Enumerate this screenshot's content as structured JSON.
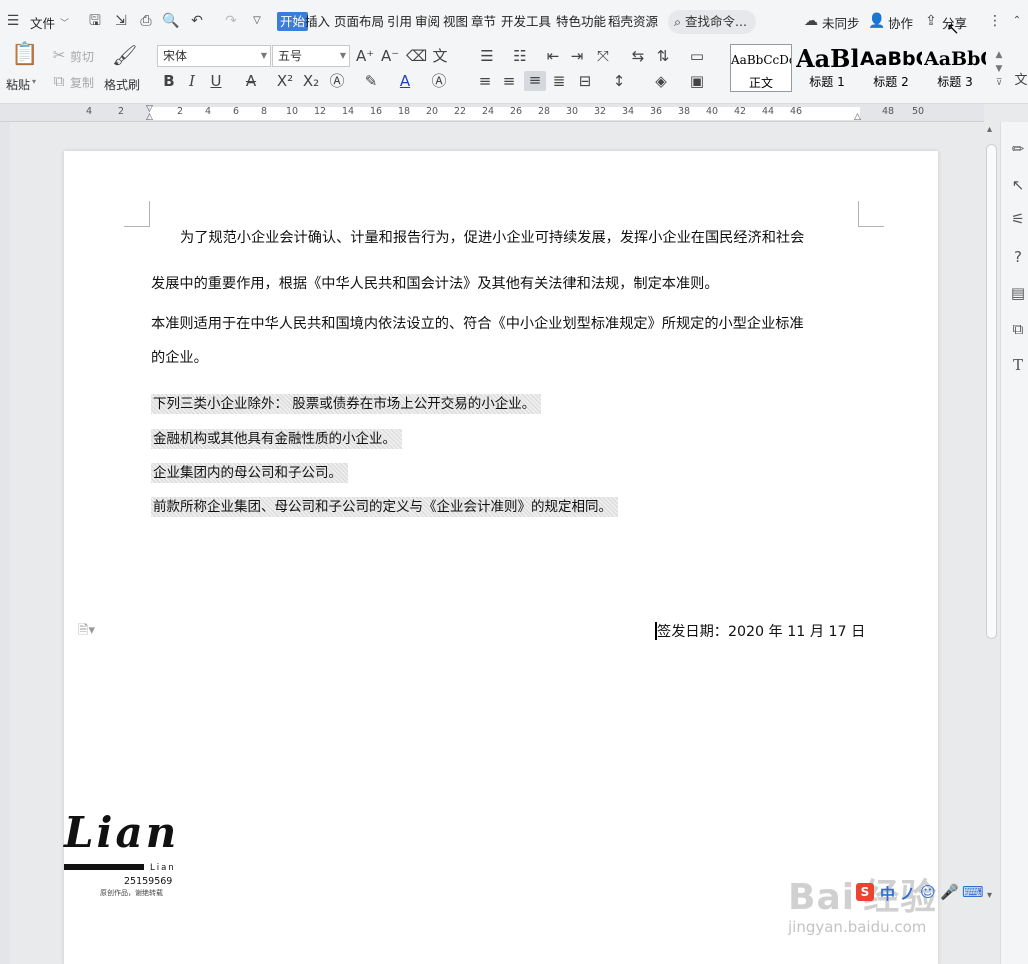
{
  "menubar": {
    "file_label": "文件",
    "tabs": [
      {
        "label": "开始",
        "active": true
      },
      {
        "label": "插入"
      },
      {
        "label": "页面布局"
      },
      {
        "label": "引用"
      },
      {
        "label": "审阅"
      },
      {
        "label": "视图"
      },
      {
        "label": "章节"
      },
      {
        "label": "开发工具"
      },
      {
        "label": "特色功能"
      },
      {
        "label": "稻壳资源"
      }
    ],
    "search_placeholder": "查找命令...",
    "unsynced_label": "未同步",
    "collab_label": "协作",
    "share_label": "分享"
  },
  "ribbon": {
    "paste_label": "粘贴",
    "cut_label": "剪切",
    "copy_label": "复制",
    "format_painter_label": "格式刷",
    "font_name": "宋体",
    "font_size": "五号",
    "styles": [
      {
        "sample": "AaBbCcDd",
        "caption": "正文"
      },
      {
        "sample": "AaBl",
        "caption": "标题 1"
      },
      {
        "sample": "AaBbC",
        "caption": "标题 2"
      },
      {
        "sample": "AaBbC",
        "caption": "标题 3"
      }
    ],
    "accent_color": "#3b7ddd"
  },
  "ruler": {
    "numbers": [
      "4",
      "2",
      "2",
      "4",
      "6",
      "8",
      "10",
      "12",
      "14",
      "16",
      "18",
      "20",
      "22",
      "24",
      "26",
      "28",
      "30",
      "32",
      "34",
      "36",
      "38",
      "40",
      "42",
      "44",
      "46",
      "48",
      "50"
    ]
  },
  "document": {
    "para1_line1": "为了规范小企业会计确认、计量和报告行为，促进小企业可持续发展，发挥小企业在国民经济和社会",
    "para1_line2": "发展中的重要作用，根据《中华人民共和国会计法》及其他有关法律和法规，制定本准则。",
    "para2_line1": "本准则适用于在中华人民共和国境内依法设立的、符合《中小企业划型标准规定》所规定的小型企业标准",
    "para2_line2": "的企业。",
    "highlighted_lines": [
      "下列三类小企业除外：  股票或债券在市场上公开交易的小企业。",
      "金融机构或其他具有金融性质的小企业。",
      "企业集团内的母公司和子公司。",
      "前款所称企业集团、母公司和子公司的定义与《企业会计准则》的规定相同。"
    ],
    "sign_date": "签发日期：2020 年 11 月 17 日"
  },
  "watermark": {
    "logo_text": "Lian",
    "logo_sub": "Lian",
    "logo_number": "25159569",
    "logo_caption": "原创作品，谢绝转载",
    "baidu_text": "Bai 经验",
    "baidu_url": "jingyan.baidu.com",
    "ime_simplified": "简"
  }
}
